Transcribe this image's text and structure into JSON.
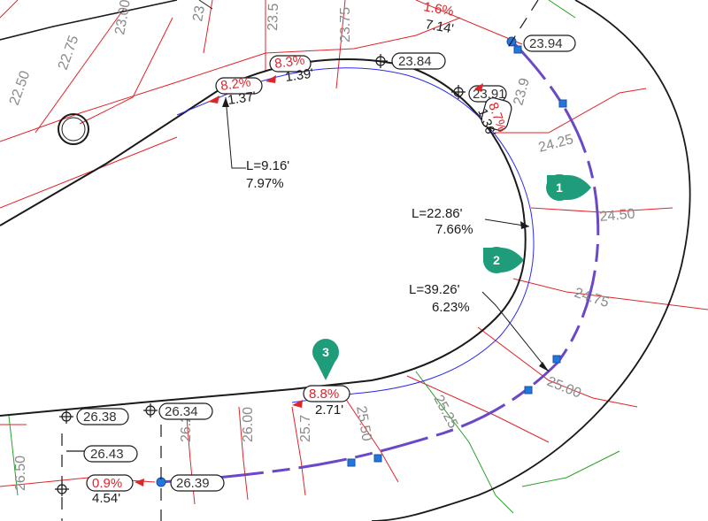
{
  "contours": {
    "c2250": "22.50",
    "c2275": "22.75",
    "c2300": "23.00",
    "c2325": "23",
    "c2350": "23.5",
    "c2375": "23.75",
    "c2425": "24.25",
    "c2450": "24.50",
    "c2475": "24.75",
    "c2500": "25.00",
    "c2525": "25.25",
    "c2550": "25.50",
    "c2575": "25.7",
    "c2600": "26.00",
    "c2625": "26.2",
    "c2650": "26.50",
    "c2590": "23.9"
  },
  "elevations": {
    "e1": "23.94",
    "e2": "23.84",
    "e3": "23.91",
    "e4": "26.38",
    "e5": "26.34",
    "e6": "26.43",
    "e7": "26.39"
  },
  "slopes": {
    "s1_grade": "1.6%",
    "s1_len": "7.14'",
    "s2_grade": "8.2%",
    "s2_len": "1.37'",
    "s3_grade": "8.3%",
    "s3_len": "1.39'",
    "s4_grade": "8.7%",
    "s4_len": "1.36'",
    "s5_grade": "8.8%",
    "s5_len": "2.71'",
    "s6_grade": "0.9%",
    "s6_len": "4.54'"
  },
  "leaders": {
    "l1_len": "L=9.16'",
    "l1_pct": "7.97%",
    "l2_len": "L=22.86'",
    "l2_pct": "7.66%",
    "l3_len": "L=39.26'",
    "l3_pct": "6.23%"
  },
  "callouts": {
    "c1": "1",
    "c2": "2",
    "c3": "3"
  },
  "colors": {
    "contour": "#e0242a",
    "curb": "#1a1a1a",
    "gutter": "#2a2aee",
    "profile": "#6a48c8",
    "callout": "#1f9d7a",
    "green": "#2aa02a"
  }
}
